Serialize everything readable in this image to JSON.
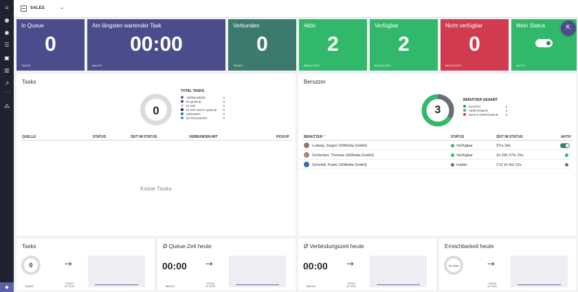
{
  "topbar": {
    "title": "SALES"
  },
  "tiles": [
    {
      "title": "In Queue",
      "value": "0",
      "footer": "TASKS"
    },
    {
      "title": "Am längsten wartender Task",
      "value": "00:00",
      "footer": "MM:SS"
    },
    {
      "title": "Verbunden",
      "value": "0",
      "footer": "TASKS"
    },
    {
      "title": "Aktiv",
      "value": "2",
      "footer": "BENUTZER"
    },
    {
      "title": "Verfügbar",
      "value": "2",
      "footer": "BENUTZER"
    },
    {
      "title": "Nicht verfügbar",
      "value": "0",
      "footer": "BENUTZER"
    },
    {
      "title": "Mein Status",
      "footer": "AKTIV",
      "toggle_on": true
    }
  ],
  "tasks_panel": {
    "title": "Tasks",
    "donut_value": "0",
    "legend_title": "TOTAL TASKS",
    "legend": [
      {
        "label": "VERBUNDEN",
        "count": "0",
        "color": "#3c7a6d"
      },
      {
        "label": "IN QUEUE",
        "count": "0",
        "color": "#4b4c8b"
      },
      {
        "label": "IN IVR",
        "count": "0",
        "color": "#d0d0d0"
      },
      {
        "label": "IN IVR NACH QUEUE",
        "count": "0",
        "color": "#1f2330"
      },
      {
        "label": "GEPARKT",
        "count": "0",
        "color": "#2f6fb0"
      },
      {
        "label": "IM TRANSFER",
        "count": "0",
        "color": "#3aa0a8"
      }
    ],
    "columns": [
      "QUELLE",
      "STATUS",
      "ZEIT IM STATUS",
      "VERBUNDEN MIT",
      "PICKUP"
    ],
    "empty_text": "Keine Tasks"
  },
  "users_panel": {
    "title": "Benutzer",
    "donut_value": "3",
    "legend_title": "BENUTZER GESAMT",
    "legend": [
      {
        "label": "INAKTIV",
        "count": "1",
        "color": "#6a6d75"
      },
      {
        "label": "VERFÜGBAR",
        "count": "2",
        "color": "#32b86a"
      },
      {
        "label": "NICHT VERFÜGBAR",
        "count": "0",
        "color": "#d03b4f"
      }
    ],
    "columns": [
      "BENUTZER",
      "STATUS",
      "ZEIT IM STATUS",
      "AKTIV"
    ],
    "sort_indicator": "^",
    "rows": [
      {
        "name": "Ludwig, Jürgen (SIMedia GmbH)",
        "status": "Verfügbar",
        "status_color": "#32b86a",
        "time": "37m 34s",
        "active": "toggle"
      },
      {
        "name": "Schlenker, Thomas (SIMedia GmbH)",
        "status": "Verfügbar",
        "status_color": "#32b86a",
        "time": "1d 20h 27m 15s",
        "active": "green"
      },
      {
        "name": "Schmidt, Frank (SIMedia GmbH)",
        "status": "Inaktiv",
        "status_color": "#6a6d75",
        "time": "17d 1h 0m 12s",
        "active": "gray"
      }
    ]
  },
  "stats": [
    {
      "title": "Tasks",
      "value": "0",
      "footer": "TASKS",
      "trend": "TREND\n30 TAGE"
    },
    {
      "title": "Ø Queue-Zeit heute",
      "value": "00:00",
      "footer": "MM:SS",
      "trend": "TREND\n30 TAGE"
    },
    {
      "title": "Ø Verbindungszeit heute",
      "value": "00:00",
      "footer": "MM:SS",
      "trend": "TREND\n30 TAGE"
    },
    {
      "title": "Erreichbarkeit heute",
      "value": "No Data",
      "footer": "",
      "trend": "TREND\n30 TAGE"
    }
  ]
}
